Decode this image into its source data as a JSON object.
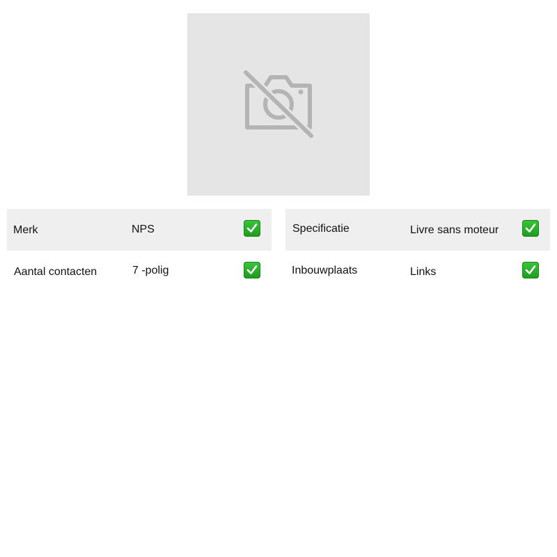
{
  "product_image": {
    "icon": "no-photo-icon",
    "background_color": "#e5e5e5",
    "icon_color": "#b4b4b4"
  },
  "specs_left": [
    {
      "label": "Merk",
      "value": "NPS",
      "check_icon": "check-mark-button-icon"
    },
    {
      "label": "Aantal contacten",
      "value": "7 -polig",
      "check_icon": "check-mark-button-icon"
    }
  ],
  "specs_right": [
    {
      "label": "Specificatie",
      "value": "Livre sans moteur",
      "check_icon": "check-mark-button-icon"
    },
    {
      "label": "Inbouwplaats",
      "value": "Links",
      "check_icon": "check-mark-button-icon"
    }
  ],
  "colors": {
    "row_shade": "#efefef",
    "check_green": "#2bb22b"
  }
}
